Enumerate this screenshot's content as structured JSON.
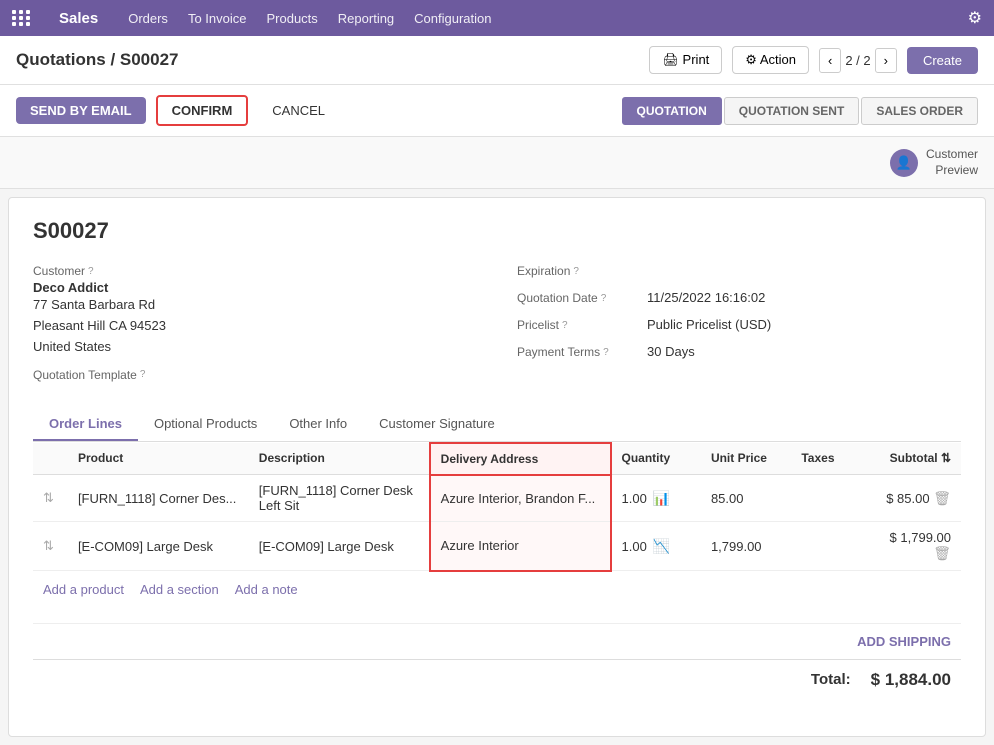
{
  "nav": {
    "brand": "Sales",
    "items": [
      "Orders",
      "To Invoice",
      "Products",
      "Reporting",
      "Configuration"
    ]
  },
  "breadcrumb": {
    "text": "Quotations / S00027",
    "print_label": "🖨 Print",
    "action_label": "⚙ Action",
    "pagination": "2 / 2",
    "create_label": "Create"
  },
  "action_bar": {
    "send_label": "SEND BY EMAIL",
    "confirm_label": "CONFIRM",
    "cancel_label": "CANCEL"
  },
  "status_tabs": [
    {
      "label": "QUOTATION",
      "active": true
    },
    {
      "label": "QUOTATION SENT",
      "active": false
    },
    {
      "label": "SALES ORDER",
      "active": false
    }
  ],
  "customer_preview": {
    "icon": "👤",
    "label": "Customer\nPreview"
  },
  "form": {
    "doc_number": "S00027",
    "customer_label": "Customer",
    "customer_name": "Deco Addict",
    "customer_address": "77 Santa Barbara Rd\nPleasant Hill CA 94523\nUnited States",
    "template_label": "Quotation Template",
    "expiration_label": "Expiration",
    "expiration_value": "",
    "quotation_date_label": "Quotation Date",
    "quotation_date_value": "11/25/2022 16:16:02",
    "pricelist_label": "Pricelist",
    "pricelist_value": "Public Pricelist (USD)",
    "payment_terms_label": "Payment Terms",
    "payment_terms_value": "30 Days"
  },
  "tabs": [
    {
      "label": "Order Lines",
      "active": true
    },
    {
      "label": "Optional Products",
      "active": false
    },
    {
      "label": "Other Info",
      "active": false
    },
    {
      "label": "Customer Signature",
      "active": false
    }
  ],
  "table": {
    "headers": [
      "",
      "Product",
      "Description",
      "Delivery Address",
      "Quantity",
      "Unit Price",
      "Taxes",
      "Subtotal"
    ],
    "rows": [
      {
        "product": "[FURN_1118] Corner Des...",
        "description": "[FURN_1118] Corner Desk\nLeft Sit",
        "delivery": "Azure Interior, Brandon F...",
        "quantity": "1.00",
        "chart_type": "blue",
        "unit_price": "85.00",
        "taxes": "",
        "subtotal": "$ 85.00"
      },
      {
        "product": "[E-COM09] Large Desk",
        "description": "[E-COM09] Large Desk",
        "delivery": "Azure Interior",
        "quantity": "1.00",
        "chart_type": "red",
        "unit_price": "1,799.00",
        "taxes": "",
        "subtotal": "$ 1,799.00"
      }
    ],
    "add_product": "Add a product",
    "add_section": "Add a section",
    "add_note": "Add a note"
  },
  "footer": {
    "add_shipping": "ADD SHIPPING",
    "total_label": "Total:",
    "total_value": "$ 1,884.00"
  }
}
